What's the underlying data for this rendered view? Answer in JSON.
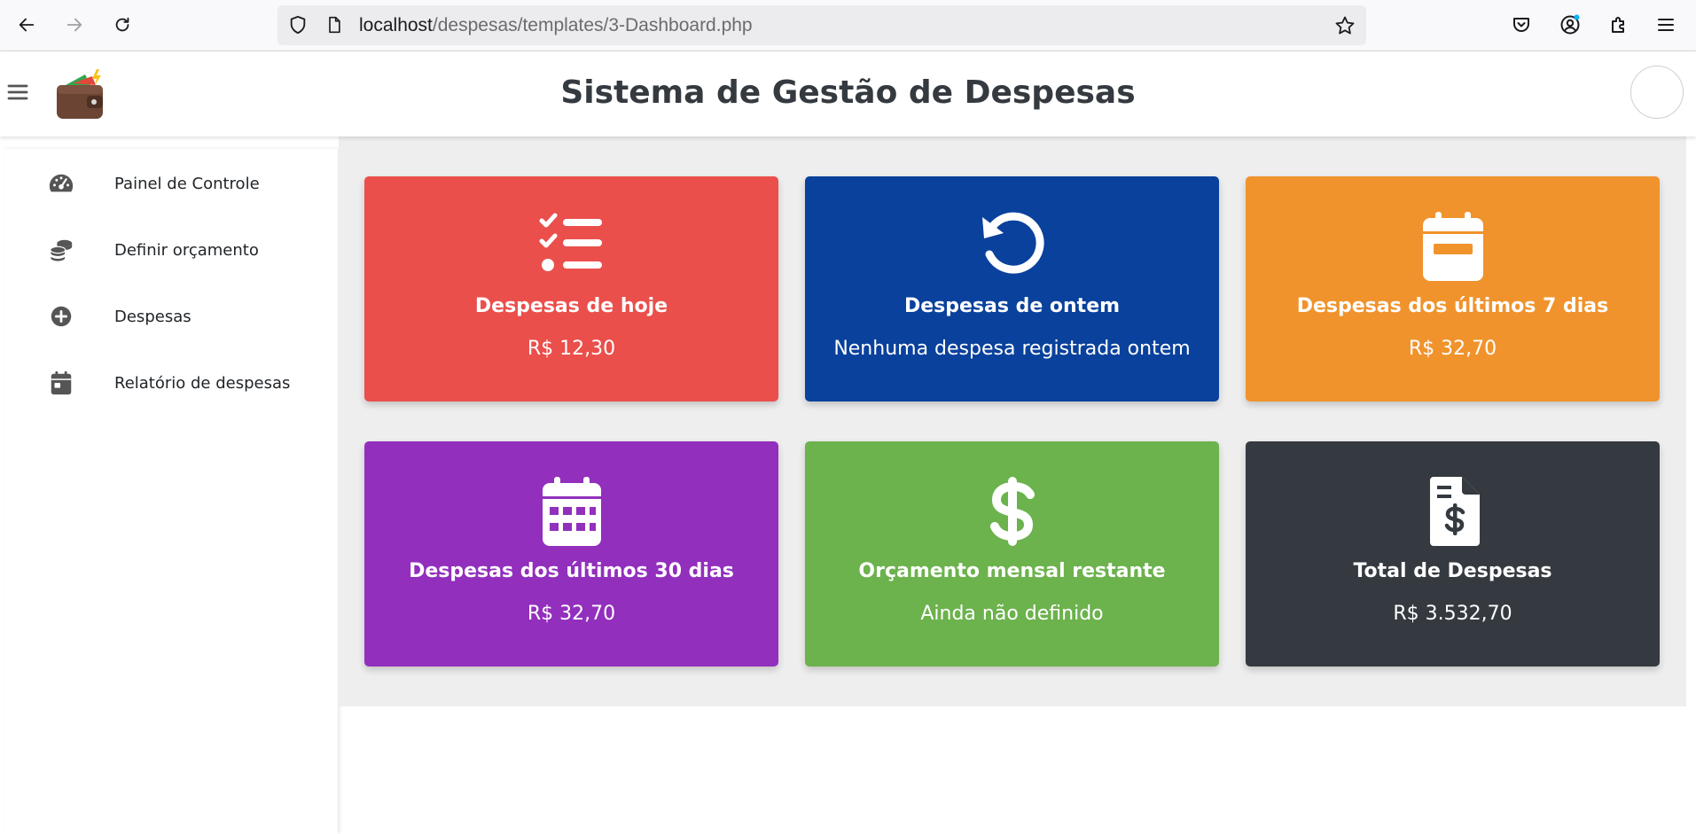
{
  "browser": {
    "url_host": "localhost",
    "url_path": "/despesas/templates/3-Dashboard.php"
  },
  "header": {
    "title": "Sistema de Gestão de Despesas"
  },
  "sidebar": {
    "items": [
      {
        "label": "Painel de Controle",
        "icon": "gauge-icon"
      },
      {
        "label": "Definir orçamento",
        "icon": "coins-icon"
      },
      {
        "label": "Despesas",
        "icon": "plus-circle-icon"
      },
      {
        "label": "Relatório de despesas",
        "icon": "calendar-icon"
      }
    ]
  },
  "cards": [
    {
      "title": "Despesas de hoje",
      "value": "R$ 12,30",
      "color": "#ea4f4b",
      "icon": "list-check-icon"
    },
    {
      "title": "Despesas de ontem",
      "value": "Nenhuma despesa registrada ontem",
      "color": "#0a419c",
      "icon": "rotate-left-icon"
    },
    {
      "title": "Despesas dos últimos 7 dias",
      "value": "R$ 32,70",
      "color": "#f0932c",
      "icon": "calendar-minus-icon"
    },
    {
      "title": "Despesas dos últimos 30 dias",
      "value": "R$ 32,70",
      "color": "#922fbd",
      "icon": "calendar-days-icon"
    },
    {
      "title": "Orçamento mensal restante",
      "value": "Ainda não definido",
      "color": "#6cb24d",
      "icon": "dollar-sign-icon"
    },
    {
      "title": "Total de Despesas",
      "value": "R$ 3.532,70",
      "color": "#343a40",
      "icon": "file-invoice-dollar-icon"
    }
  ]
}
